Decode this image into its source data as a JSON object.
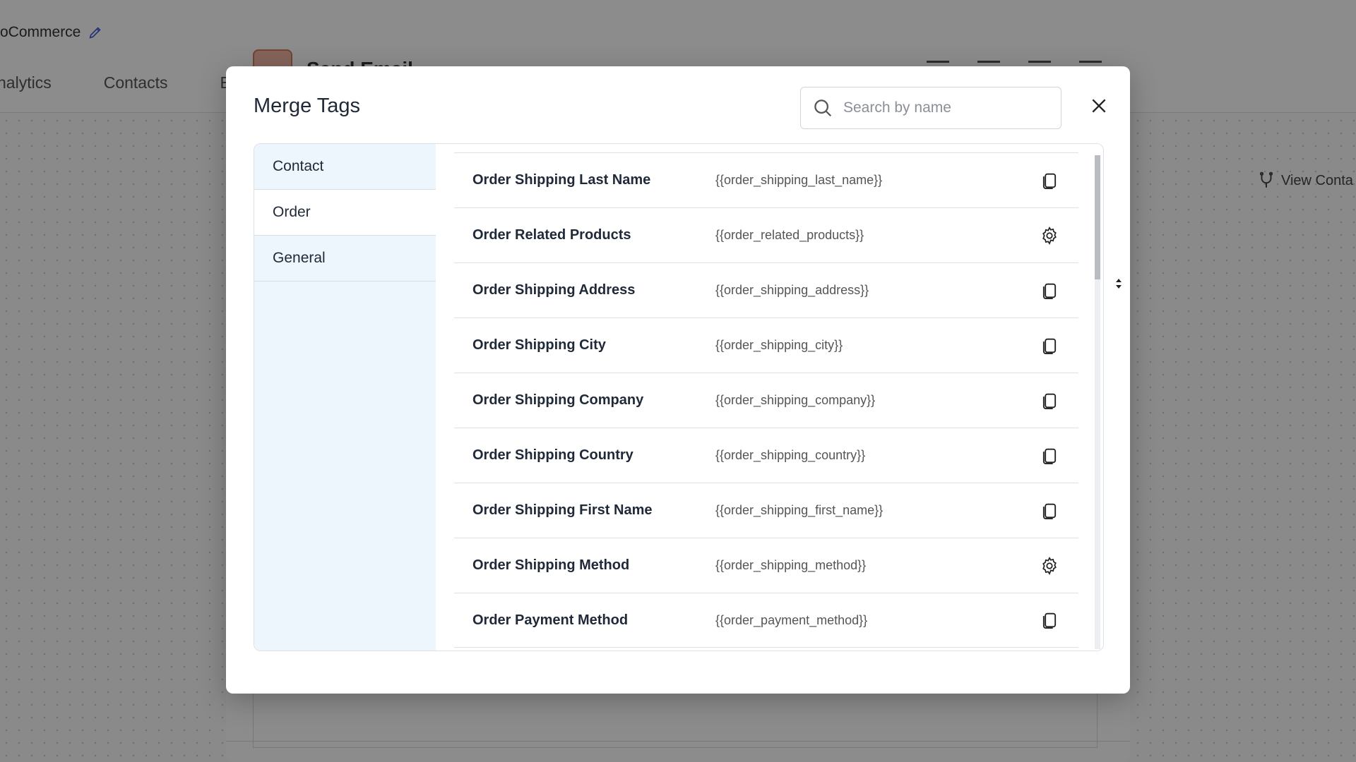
{
  "background": {
    "breadcrumb": "oCommerce",
    "nav_items": [
      "nalytics",
      "Contacts",
      "E"
    ],
    "view_contact": "View Conta",
    "panel_title": "Send Email"
  },
  "modal": {
    "title": "Merge Tags",
    "search_placeholder": "Search by name",
    "categories": [
      {
        "label": "Contact",
        "active": false
      },
      {
        "label": "Order",
        "active": true
      },
      {
        "label": "General",
        "active": false
      }
    ],
    "rows": [
      {
        "label": "Order Shipping Last Name",
        "tag": "{{order_shipping_last_name}}",
        "action_icon": "copy-icon"
      },
      {
        "label": "Order Related Products",
        "tag": "{{order_related_products}}",
        "action_icon": "gear-icon"
      },
      {
        "label": "Order Shipping Address",
        "tag": "{{order_shipping_address}}",
        "action_icon": "copy-icon"
      },
      {
        "label": "Order Shipping City",
        "tag": "{{order_shipping_city}}",
        "action_icon": "copy-icon"
      },
      {
        "label": "Order Shipping Company",
        "tag": "{{order_shipping_company}}",
        "action_icon": "copy-icon"
      },
      {
        "label": "Order Shipping Country",
        "tag": "{{order_shipping_country}}",
        "action_icon": "copy-icon"
      },
      {
        "label": "Order Shipping First Name",
        "tag": "{{order_shipping_first_name}}",
        "action_icon": "copy-icon"
      },
      {
        "label": "Order Shipping Method",
        "tag": "{{order_shipping_method}}",
        "action_icon": "gear-icon"
      },
      {
        "label": "Order Payment Method",
        "tag": "{{order_payment_method}}",
        "action_icon": "copy-icon"
      }
    ]
  },
  "colors": {
    "overlay": "#00000073",
    "sidebar_bg": "#eef6fd",
    "text": "#1f2937"
  }
}
